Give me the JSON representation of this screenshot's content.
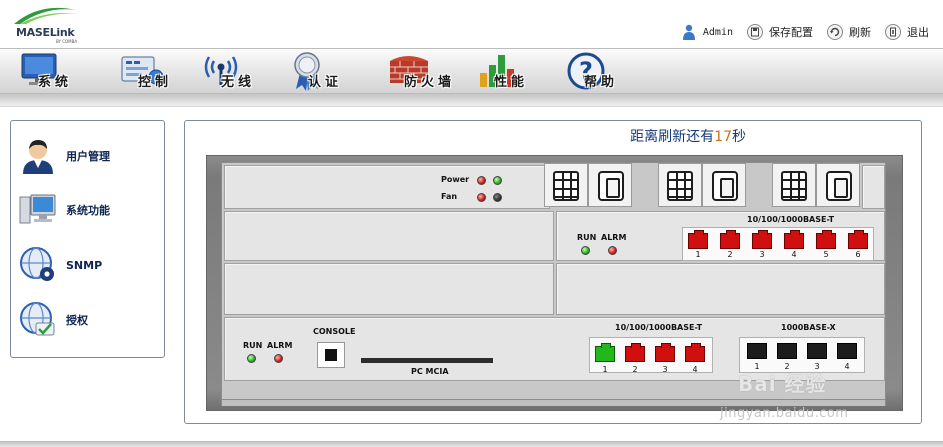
{
  "header": {
    "logo_text": "MASELink",
    "logo_subtext": "BY COMBA",
    "user": "Admin",
    "save_label": "保存配置",
    "refresh_label": "刷新",
    "logout_label": "退出"
  },
  "nav": [
    {
      "label": "系统",
      "icon": "monitor-icon"
    },
    {
      "label": "控制",
      "icon": "control-panel-icon"
    },
    {
      "label": "无线",
      "icon": "wireless-antenna-icon"
    },
    {
      "label": "认证",
      "icon": "certificate-badge-icon"
    },
    {
      "label": "防火墙",
      "icon": "firewall-icon"
    },
    {
      "label": "性能",
      "icon": "bar-chart-icon"
    },
    {
      "label": "帮助",
      "icon": "question-mark-icon"
    }
  ],
  "sidebar": {
    "items": [
      {
        "label": "用户管理",
        "icon": "user-icon"
      },
      {
        "label": "系统功能",
        "icon": "computer-icon"
      },
      {
        "label": "SNMP",
        "icon": "globe-gear-icon"
      },
      {
        "label": "授权",
        "icon": "globe-check-icon"
      }
    ]
  },
  "main": {
    "refresh_prefix": "距离刷新还有",
    "refresh_count": "17",
    "refresh_suffix": "秒"
  },
  "device": {
    "power_label": "Power",
    "fan_label": "Fan",
    "upper_card": {
      "run_label": "RUN",
      "alarm_label": "ALRM",
      "ports_title": "10/100/1000BASE-T",
      "ports": [
        "1",
        "2",
        "3",
        "4",
        "5",
        "6"
      ]
    },
    "main_card": {
      "run_label": "RUN",
      "alarm_label": "ALRM",
      "console_label": "CONSOLE",
      "pcmcia_label": "PC MCIA",
      "copper_title": "10/100/1000BASE-T",
      "copper_ports": [
        "1",
        "2",
        "3",
        "4"
      ],
      "fiber_title": "1000BASE-X",
      "fiber_ports": [
        "1",
        "2",
        "3",
        "4"
      ]
    }
  },
  "watermark": {
    "brand": "Bai 经验",
    "url": "jingyan.baidu.com"
  },
  "colors": {
    "port_red": "#d20f0f",
    "port_green": "#22b81c",
    "nav_text": "#1a1a1a",
    "menu_text": "#0e2452",
    "countdown": "#c9721b"
  }
}
